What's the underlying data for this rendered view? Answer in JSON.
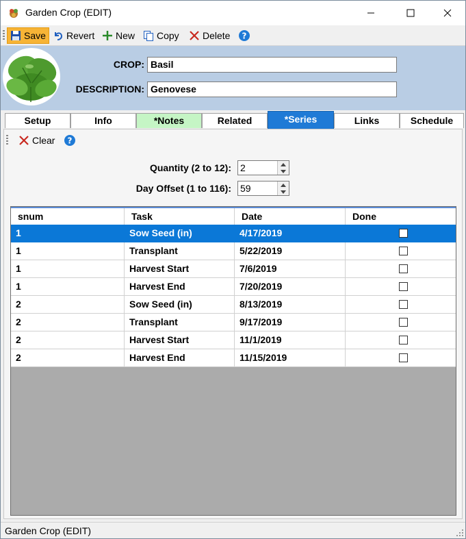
{
  "window": {
    "title": "Garden Crop (EDIT)"
  },
  "toolbar": {
    "save_label": "Save",
    "revert_label": "Revert",
    "new_label": "New",
    "copy_label": "Copy",
    "delete_label": "Delete"
  },
  "header": {
    "crop_label": "CROP:",
    "crop_value": "Basil",
    "description_label": "DESCRIPTION:",
    "description_value": "Genovese"
  },
  "tabs": [
    {
      "label": "Setup"
    },
    {
      "label": "Info"
    },
    {
      "label": "*Notes"
    },
    {
      "label": "Related"
    },
    {
      "label": "*Series"
    },
    {
      "label": "Links"
    },
    {
      "label": "Schedule"
    }
  ],
  "selected_tab": "*Series",
  "series": {
    "clear_label": "Clear",
    "quantity_label": "Quantity (2 to 12):",
    "quantity_value": "2",
    "offset_label": "Day Offset (1 to 116):",
    "offset_value": "59",
    "columns": [
      "snum",
      "Task",
      "Date",
      "Done"
    ],
    "rows": [
      {
        "snum": "1",
        "task": "Sow Seed (in)",
        "date": "4/17/2019",
        "done": false
      },
      {
        "snum": "1",
        "task": "Transplant",
        "date": "5/22/2019",
        "done": false
      },
      {
        "snum": "1",
        "task": "Harvest Start",
        "date": "7/6/2019",
        "done": false
      },
      {
        "snum": "1",
        "task": "Harvest End",
        "date": "7/20/2019",
        "done": false
      },
      {
        "snum": "2",
        "task": "Sow Seed (in)",
        "date": "8/13/2019",
        "done": false
      },
      {
        "snum": "2",
        "task": "Transplant",
        "date": "9/17/2019",
        "done": false
      },
      {
        "snum": "2",
        "task": "Harvest Start",
        "date": "11/1/2019",
        "done": false
      },
      {
        "snum": "2",
        "task": "Harvest End",
        "date": "11/15/2019",
        "done": false
      }
    ]
  },
  "status": {
    "text": "Garden Crop (EDIT)"
  },
  "colors": {
    "header_bg": "#b9cde4",
    "selected_tab": "#1f7ad6",
    "notes_tab": "#c5f5c5",
    "selected_row": "#0b78d7",
    "save_highlight": "#f7b436"
  }
}
